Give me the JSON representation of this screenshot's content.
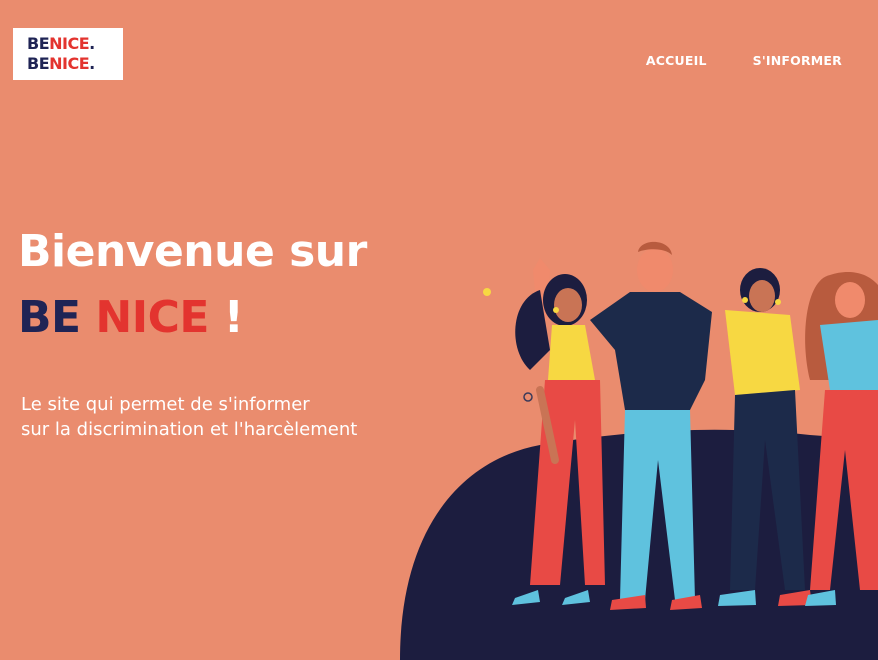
{
  "logo": {
    "line1_be": "BE",
    "line1_nice": "NICE",
    "line1_dot": ".",
    "line2_be": "BE",
    "line2_nice": "NICE",
    "line2_dot": "."
  },
  "nav": {
    "items": [
      {
        "label": "ACCUEIL"
      },
      {
        "label": "S'INFORMER"
      }
    ]
  },
  "hero": {
    "title_line1": "Bienvenue sur",
    "brand_be": "BE ",
    "brand_nice": "NICE",
    "brand_bang": " !",
    "subtitle_line1": "Le site qui permet de s'informer",
    "subtitle_line2": "sur la discrimination et l'harcèlement"
  },
  "colors": {
    "background": "#ea8c6e",
    "navy": "#1f2455",
    "red": "#e3342f",
    "white": "#ffffff"
  },
  "illustration": {
    "icon": "group-of-friends-illustration"
  }
}
